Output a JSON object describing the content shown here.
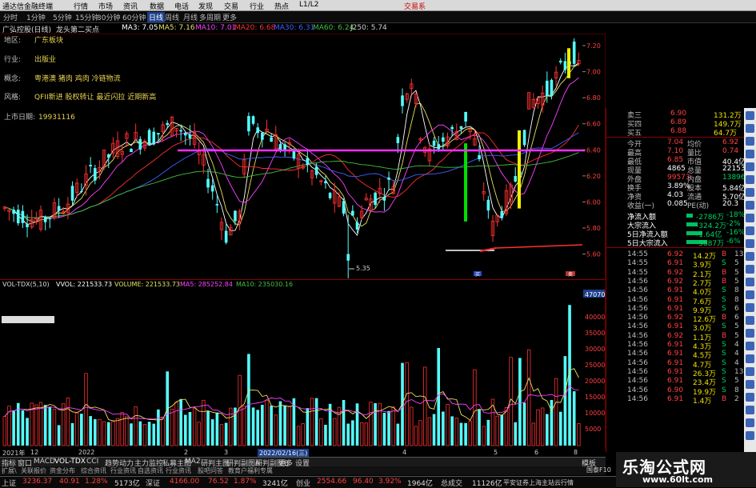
{
  "menubar": {
    "app_title": "通达信金融终端",
    "items": [
      "行情",
      "市场",
      "资讯",
      "数据",
      "电话",
      "发现",
      "交易",
      "行业",
      "热点",
      "L1/L2"
    ],
    "right": "交易系"
  },
  "periodbar": {
    "items": [
      "分时",
      "1分钟",
      "5分钟",
      "15分钟",
      "30分钟",
      "60分钟",
      "日线",
      "周线",
      "月线",
      "多周期",
      "更多"
    ],
    "active_index": 6
  },
  "stock_header": {
    "name": "广弘控股(日线)",
    "indicator": "龙头第二买点",
    "ma3": "MA3: 7.05",
    "ma5": "MA5: 7.16",
    "ma10": "MA10: 7.01",
    "ma20": "MA20: 6.68",
    "ma30": "MA30: 6.31",
    "ma60": "MA60: 6.24",
    "j250": "J250: 5.74"
  },
  "info_overlay": [
    {
      "key": "地区:",
      "value": "广东板块"
    },
    {
      "key": "行业:",
      "value": "出版业"
    },
    {
      "key": "概念:",
      "value": "粤港澳 猪肉 鸡肉 冷链物流"
    },
    {
      "key": "风格:",
      "value": "QFII新进 股权转让 最近闪拉 近期新高"
    },
    {
      "key": "上市日期:",
      "value": "19931116"
    }
  ],
  "price_axis": [
    "7.20",
    "7.00",
    "6.80",
    "6.60",
    "6.40",
    "6.20",
    "6.00",
    "5.80",
    "5.60"
  ],
  "low_marker": "5.35",
  "vol_header": {
    "name": "VOL-TDX(5,10)",
    "vvol": "VVOL: 221533.73",
    "volume": "VOLUME: 221533.73",
    "ma5": "MA5: 285252.84",
    "ma10": "MA10: 235030.16"
  },
  "vol_axis": [
    "47070",
    "40000",
    "35000",
    "30000",
    "25000",
    "20000",
    "15000",
    "10000",
    "5000"
  ],
  "vol_max_label": "47070",
  "date_axis": [
    "2021年",
    "12",
    "2022",
    "2",
    "3",
    "2022/02/16(三)",
    "4",
    "5",
    "6",
    "8"
  ],
  "quote": {
    "sell3": {
      "label": "卖三",
      "price": "6.90",
      "vol": "131.2万"
    },
    "sell4": {
      "label": "买四",
      "price": "6.89",
      "vol": "149.7万"
    },
    "sell5": {
      "label": "买五",
      "price": "6.88",
      "vol": "64.7万"
    },
    "rows": [
      {
        "k1": "今开",
        "v1": "7.04",
        "k2": "均价",
        "v2": "6.92"
      },
      {
        "k1": "最高",
        "v1": "7.10",
        "k2": "量比",
        "v2": "0.74"
      },
      {
        "k1": "最低",
        "v1": "6.85",
        "k2": "市值",
        "v2": "40.4亿"
      },
      {
        "k1": "现量",
        "v1": "4865",
        "k2": "总量",
        "v2": "221534"
      },
      {
        "k1": "外盘",
        "v1": "99573",
        "k2": "内盘",
        "v2": "138961"
      },
      {
        "k1": "换手",
        "v1": "3.89%",
        "k2": "股本",
        "v2": "5.84亿"
      },
      {
        "k1": "净资",
        "v1": "4.03",
        "k2": "流通",
        "v2": "5.70亿"
      },
      {
        "k1": "收益(一)",
        "v1": "0.085",
        "k2": "PE(动)",
        "v2": "20.3"
      }
    ],
    "flows": [
      {
        "label": "净流入额",
        "value": "-2786万",
        "pct": "-18%"
      },
      {
        "label": "大宗流入",
        "value": "-324.2万",
        "pct": "-2%"
      },
      {
        "label": "5日净流入额",
        "value": "-1.64亿",
        "pct": "-16%"
      },
      {
        "label": "5日大宗流入",
        "value": "-5887万",
        "pct": "-6%"
      }
    ],
    "ticks": [
      {
        "t": "14:55",
        "p": "6.92",
        "v": "14.2万",
        "s": "B",
        "n": "13"
      },
      {
        "t": "14:55",
        "p": "6.91",
        "v": "3.9万",
        "s": "S",
        "n": "5"
      },
      {
        "t": "14:55",
        "p": "6.92",
        "v": "2.1万",
        "s": "B",
        "n": "5"
      },
      {
        "t": "14:56",
        "p": "6.92",
        "v": "2.7万",
        "s": "B",
        "n": "5"
      },
      {
        "t": "14:56",
        "p": "6.91",
        "v": "4.0万",
        "s": "S",
        "n": "8"
      },
      {
        "t": "14:56",
        "p": "6.91",
        "v": "7.6万",
        "s": "S",
        "n": "8"
      },
      {
        "t": "14:56",
        "p": "6.91",
        "v": "9.9万",
        "s": "S",
        "n": "6"
      },
      {
        "t": "14:56",
        "p": "6.92",
        "v": "12.6万",
        "s": "B",
        "n": "6"
      },
      {
        "t": "14:56",
        "p": "6.91",
        "v": "3.0万",
        "s": "S",
        "n": "5"
      },
      {
        "t": "14:56",
        "p": "6.92",
        "v": "1.1万",
        "s": "B",
        "n": "5"
      },
      {
        "t": "14:56",
        "p": "6.91",
        "v": "4.3万",
        "s": "S",
        "n": "4"
      },
      {
        "t": "14:56",
        "p": "6.91",
        "v": "4.5万",
        "s": "S",
        "n": "4"
      },
      {
        "t": "14:56",
        "p": "6.91",
        "v": "4.7万",
        "s": "S",
        "n": "4"
      },
      {
        "t": "14:56",
        "p": "6.91",
        "v": "26.3万",
        "s": "S",
        "n": "13"
      },
      {
        "t": "14:56",
        "p": "6.91",
        "v": "23.4万",
        "s": "S",
        "n": "5"
      },
      {
        "t": "14:56",
        "p": "6.90",
        "v": "19.9万",
        "s": "S",
        "n": "8"
      },
      {
        "t": "14:56",
        "p": "6.91",
        "v": "1.4万",
        "s": "B",
        "n": "2"
      }
    ],
    "chart_labels": {
      "buy": "买",
      "sell": "卖"
    }
  },
  "tabbar": {
    "items": [
      "指标",
      "窗口",
      "MACD",
      "VOL-TDX",
      "CCI",
      "趋势动力",
      "主力监控",
      "私募主图",
      "MA2",
      "研判主图",
      "研判副图A",
      "研判副图B",
      "更多",
      "设置"
    ],
    "right": "模板",
    "active_index": 3
  },
  "subbar": {
    "items": [
      "扩展\\",
      "关联报价",
      "资金分布",
      "综合资讯",
      "行业资讯",
      "自选资讯",
      "行业资讯",
      "股吧问答",
      "教育户福利专属"
    ]
  },
  "indexbar": {
    "sh": {
      "label": "上证",
      "value": "3236.37",
      "chg": "40.91",
      "pct": "1.28%",
      "amt": "5173亿"
    },
    "sz": {
      "label": "深证",
      "value": "4166.00",
      "chg": "76.52",
      "pct": "1.87%",
      "amt": "3241亿"
    },
    "cy": {
      "label": "创业",
      "value": "2554.66",
      "chg": "96.40",
      "pct": "3.92%",
      "amt": "1964亿"
    },
    "total": {
      "label": "总成交",
      "value": "11126亿"
    },
    "msg": "平安证券上海主站云行情",
    "extra": "国泰F10"
  },
  "watermark": {
    "cn": "乐淘公式网",
    "url": "www.60lt.com"
  },
  "colors": {
    "up": "#ff3030",
    "down": "#54ffff",
    "ma_yellow": "#e8e060",
    "ma_magenta": "#ff40ff",
    "ma_green": "#40c040",
    "ma_blue": "#4060ff",
    "ma_red": "#ff3030"
  }
}
